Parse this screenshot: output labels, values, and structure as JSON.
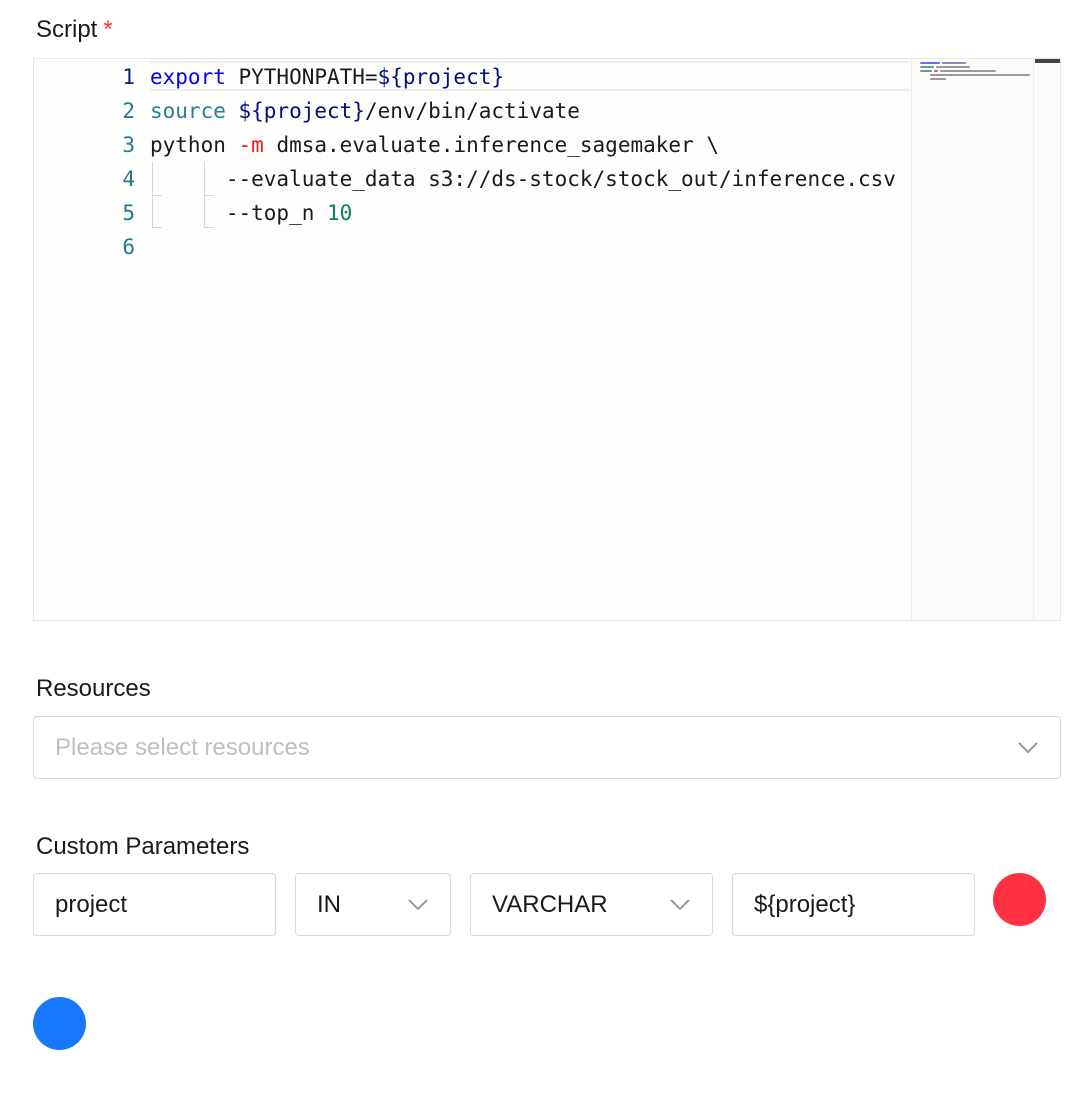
{
  "script": {
    "label": "Script",
    "required_mark": "*",
    "line_numbers": [
      "1",
      "2",
      "3",
      "4",
      "5",
      "6"
    ],
    "lines": [
      {
        "tokens": [
          {
            "t": "export",
            "c": "kw"
          },
          {
            "t": " PYTHONPATH=",
            "c": "plain"
          },
          {
            "t": "${project}",
            "c": "var"
          }
        ]
      },
      {
        "tokens": [
          {
            "t": "source",
            "c": "builtin"
          },
          {
            "t": " ",
            "c": "plain"
          },
          {
            "t": "${project}",
            "c": "var"
          },
          {
            "t": "/env/bin/activate",
            "c": "plain"
          }
        ]
      },
      {
        "tokens": [
          {
            "t": "python ",
            "c": "plain"
          },
          {
            "t": "-m",
            "c": "flag"
          },
          {
            "t": " dmsa.evaluate.inference_sagemaker \\",
            "c": "plain"
          }
        ]
      },
      {
        "tokens": [
          {
            "t": "      --evaluate_data s3://ds-stock/stock_out/inference.csv",
            "c": "plain"
          }
        ]
      },
      {
        "tokens": [
          {
            "t": "      --top_n ",
            "c": "plain"
          },
          {
            "t": "10",
            "c": "num"
          }
        ]
      },
      {
        "tokens": []
      }
    ]
  },
  "resources": {
    "label": "Resources",
    "placeholder": "Please select resources"
  },
  "custom_parameters": {
    "label": "Custom Parameters",
    "rows": [
      {
        "prop": "project",
        "direct": "IN",
        "type": "VARCHAR",
        "value": "${project}"
      }
    ],
    "delete_color": "#ff3141",
    "add_color": "#1677ff"
  },
  "colors": {
    "line_number": "#237893",
    "keyword": "#0000ff",
    "builtin": "#267f99",
    "variable": "#001080",
    "flag": "#ee1b1b",
    "number": "#098658"
  }
}
